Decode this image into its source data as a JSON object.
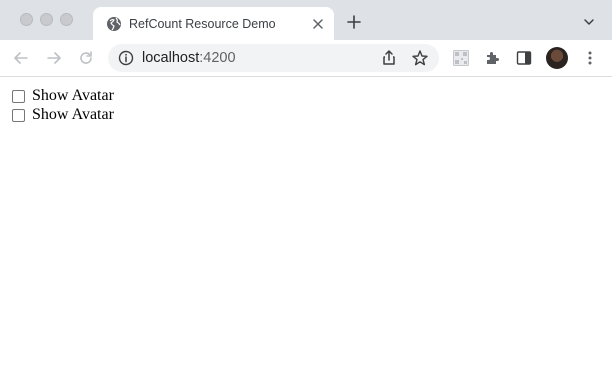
{
  "browser": {
    "tab": {
      "title": "RefCount Resource Demo",
      "favicon": "globe-icon"
    },
    "address_bar": {
      "host": "localhost",
      "port": ":4200"
    },
    "icons": {
      "new_tab": "plus-icon",
      "tab_search": "chevron-down-icon",
      "back": "arrow-left-icon",
      "forward": "arrow-right-icon",
      "reload": "reload-icon",
      "site_info": "info-icon",
      "share": "share-icon",
      "bookmark": "star-icon",
      "extension_1": "qr-code-icon",
      "extensions": "puzzle-icon",
      "side_panel": "side-panel-icon",
      "menu": "kebab-menu-icon"
    },
    "colors": {
      "tabstrip_bg": "#dee1e6",
      "omnibox_bg": "#f1f3f4",
      "icon_gray": "#5f6368"
    }
  },
  "page": {
    "checkboxes": [
      {
        "label": "Show Avatar",
        "checked": false
      },
      {
        "label": "Show Avatar",
        "checked": false
      }
    ]
  }
}
